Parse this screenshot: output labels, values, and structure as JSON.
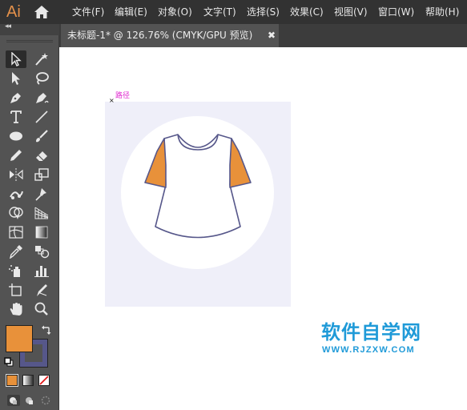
{
  "app": {
    "logo": "Ai"
  },
  "menu": {
    "items": [
      "文件(F)",
      "编辑(E)",
      "对象(O)",
      "文字(T)",
      "选择(S)",
      "效果(C)",
      "视图(V)",
      "窗口(W)",
      "帮助(H)"
    ]
  },
  "toolbar": {
    "collapse": "◂◂",
    "tools": [
      "selection-tool",
      "magic-wand-tool",
      "direct-selection-tool",
      "lasso-tool",
      "pen-tool",
      "curvature-tool",
      "type-tool",
      "line-segment-tool",
      "ellipse-tool",
      "paintbrush-tool",
      "pencil-tool",
      "eraser-tool",
      "reflect-tool",
      "scale-tool",
      "puppet-warp-tool",
      "pin-tool",
      "shape-builder-tool",
      "perspective-grid-tool",
      "mesh-tool",
      "gradient-tool",
      "eyedropper-tool",
      "blend-tool",
      "symbol-sprayer-tool",
      "column-graph-tool",
      "artboard-tool",
      "slice-tool",
      "hand-tool",
      "zoom-tool"
    ],
    "fill_color": "#e8913a",
    "stroke_color": "#56578a"
  },
  "document": {
    "tab_title": "未标题-1* @ 126.76% (CMYK/GPU 预览)",
    "close_glyph": "✖"
  },
  "canvas": {
    "path_label": "路径",
    "anchor_glyph": "×",
    "artboard_color": "#efeff9",
    "shirt_sleeve_color": "#e8913a",
    "shirt_outline_color": "#56578a"
  },
  "watermark": {
    "title": "软件自学网",
    "url": "WWW.RJZXW.COM",
    "color": "#1f9ad8"
  }
}
